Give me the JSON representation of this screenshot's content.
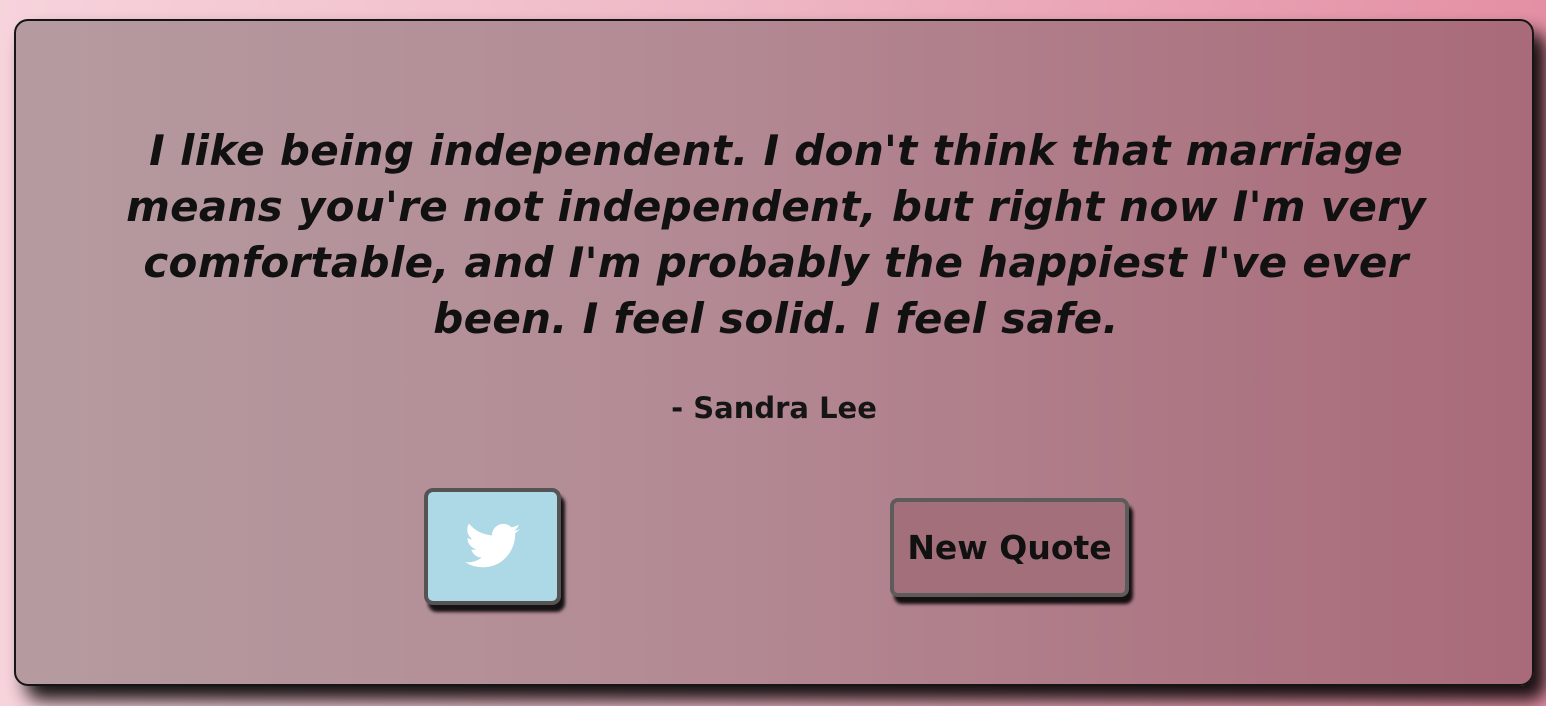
{
  "quote": {
    "text": "I like being independent. I don't think that marriage means you're not independent, but right now I'm very comfortable, and I'm probably the happiest I've ever been. I feel solid. I feel safe.",
    "author": "- Sandra Lee"
  },
  "actions": {
    "twitter_icon": "twitter-bird-icon",
    "new_quote_label": "New Quote"
  },
  "colors": {
    "background_start": "#f7d3dc",
    "background_end": "#e48fa4",
    "card_start": "#b59ba0",
    "card_end": "#a96a79",
    "twitter_button": "#add8e6",
    "new_quote_button": "#a36f7b",
    "text": "#111111"
  }
}
